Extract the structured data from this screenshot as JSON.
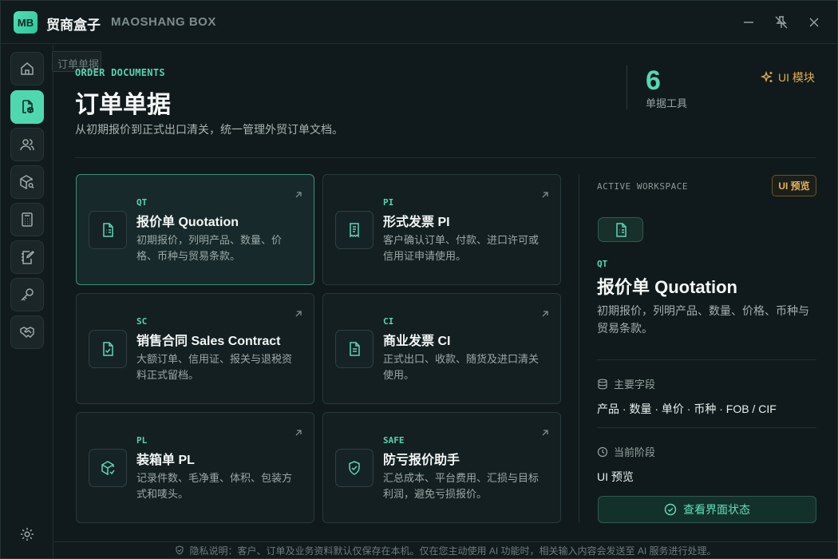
{
  "app": {
    "logo": "MB",
    "name_cn": "贸商盒子",
    "name_en": "MAOSHANG BOX"
  },
  "sidebar": {
    "items": [
      {
        "icon": "home-icon"
      },
      {
        "icon": "document-box-icon",
        "active": true,
        "tooltip": "订单单据"
      },
      {
        "icon": "users-icon"
      },
      {
        "icon": "package-search-icon"
      },
      {
        "icon": "calculator-icon"
      },
      {
        "icon": "notebook-edit-icon"
      },
      {
        "icon": "key-icon"
      },
      {
        "icon": "handshake-icon"
      }
    ],
    "settings_icon": "gear-icon"
  },
  "header": {
    "eyebrow": "ORDER DOCUMENTS",
    "title": "订单单据",
    "subtitle": "从初期报价到正式出口清关，统一管理外贸订单文档。",
    "stat_value": "6",
    "stat_label": "单据工具",
    "ui_module": "UI 模块"
  },
  "cards": [
    {
      "tag": "QT",
      "title": "报价单 Quotation",
      "desc": "初期报价，列明产品、数量、价格、币种与贸易条款。",
      "icon": "file-list-icon",
      "active": true
    },
    {
      "tag": "PI",
      "title": "形式发票 PI",
      "desc": "客户确认订单、付款、进口许可或信用证申请使用。",
      "icon": "receipt-icon"
    },
    {
      "tag": "SC",
      "title": "销售合同 Sales Contract",
      "desc": "大额订单、信用证、报关与退税资料正式留档。",
      "icon": "file-check-icon"
    },
    {
      "tag": "CI",
      "title": "商业发票 CI",
      "desc": "正式出口、收款、随货及进口清关使用。",
      "icon": "file-text-icon"
    },
    {
      "tag": "PL",
      "title": "装箱单 PL",
      "desc": "记录件数、毛净重、体积、包装方式和唛头。",
      "icon": "package-check-icon"
    },
    {
      "tag": "SAFE",
      "title": "防亏报价助手",
      "desc": "汇总成本、平台费用、汇损与目标利润，避免亏损报价。",
      "icon": "shield-check-icon"
    }
  ],
  "panel": {
    "label": "ACTIVE WORKSPACE",
    "badge": "UI 预览",
    "tag": "QT",
    "title": "报价单 Quotation",
    "desc": "初期报价，列明产品、数量、价格、币种与贸易条款。",
    "fields_label": "主要字段",
    "fields_value": "产品 · 数量 · 单价 · 币种 · FOB / CIF",
    "stage_label": "当前阶段",
    "stage_value": "UI 预览",
    "button": "查看界面状态"
  },
  "footer": {
    "text": "隐私说明：客户、订单及业务资料默认仅保存在本机。仅在您主动使用 AI 功能时，相关输入内容会发送至 AI 服务进行处理。"
  },
  "colors": {
    "accent": "#4fd8b0",
    "warning": "#e3ad4a",
    "bg": "#101a1c"
  }
}
